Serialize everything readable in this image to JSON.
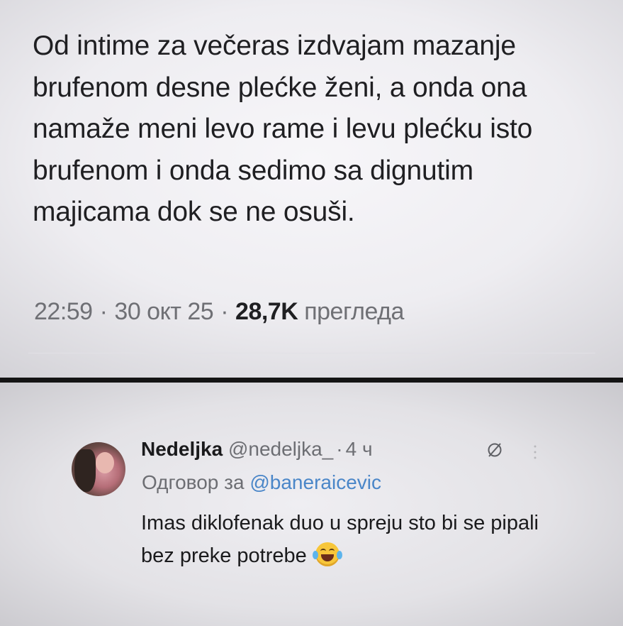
{
  "tweet": {
    "text": "Od intime za večeras izdvajam mazanje brufenom desne plećke ženi, a onda ona namaže meni levo rame i levu plećku isto brufenom i onda sedimo sa dignutim majicama dok se ne osuši.",
    "time": "22:59",
    "date": "30 окт 25",
    "views_count": "28,7K",
    "views_label": "прегледа",
    "separator": "·"
  },
  "reply": {
    "display_name": "Nedeljka",
    "handle": "@nedeljka_",
    "age": "4 ч",
    "separator": "·",
    "reply_to_label": "Одговор за",
    "reply_to_handle": "@baneraicevic",
    "text": "Imas diklofenak duo u spreju sto bi se pipali bez preke potrebe",
    "emoji_icon": "face-with-tears-of-joy-icon"
  },
  "colors": {
    "text_primary": "#1f1f22",
    "text_secondary": "#6f7075",
    "link": "#4a86c8",
    "divider": "#141414"
  }
}
